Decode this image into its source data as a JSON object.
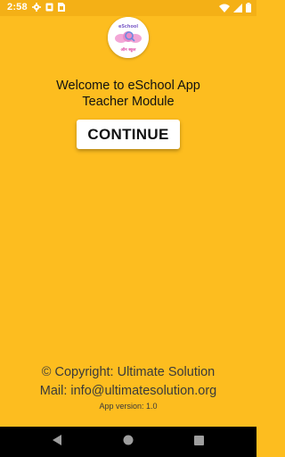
{
  "status_bar": {
    "time": "2:58",
    "icons_left": [
      "settings-gear-icon",
      "screenshot-icon",
      "sim-card-icon"
    ],
    "icons_right": [
      "wifi-icon",
      "cellular-signal-icon",
      "battery-icon"
    ]
  },
  "logo": {
    "top_text": "eSchool",
    "bottom_text": "ऑन स्कूल",
    "colors": {
      "pink": "#E052A8",
      "purple": "#7B5CC7",
      "blue": "#6A8BE0"
    }
  },
  "welcome": {
    "title": "Welcome to eSchool App",
    "subtitle": "Teacher Module"
  },
  "continue_button": {
    "label": "CONTINUE"
  },
  "footer": {
    "copyright": "© Copyright: Ultimate Solution",
    "mail": "Mail: info@ultimatesolution.org",
    "version": "App version: 1.0"
  },
  "nav_bar": {
    "buttons": [
      "back-icon",
      "home-icon",
      "recents-icon"
    ]
  },
  "colors": {
    "background": "#FDBD1F",
    "status_bar": "#F4B016",
    "button": "#FFFFFF",
    "text_primary": "#111111",
    "text_footer": "#3A3A3A",
    "nav_bar": "#000000"
  }
}
